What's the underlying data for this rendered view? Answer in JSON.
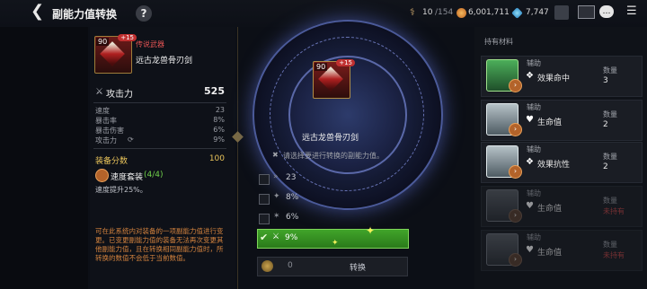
{
  "header": {
    "title": "副能力值转换",
    "help": "?",
    "resources": {
      "stamina": "10",
      "stamina_max": "/154",
      "gold": "6,001,711",
      "gems": "7,747"
    }
  },
  "weapon": {
    "level": "90",
    "enhance": "+15",
    "grade": "传说武器",
    "name": "远古龙兽骨刃剑",
    "attack_label": "攻击力",
    "attack_value": "525",
    "stats": [
      {
        "label": "速度",
        "value": "23"
      },
      {
        "label": "暴击率",
        "value": "8%"
      },
      {
        "label": "暴击伤害",
        "value": "6%"
      },
      {
        "label": "攻击力",
        "value": "9%"
      }
    ],
    "score_label": "装备分数",
    "score_value": "100",
    "set_name": "速度套装",
    "set_count": "(4/4)",
    "set_desc": "速度提升25%。",
    "notice": "可在此系统内对装备的一项副能力值进行变更。已变更副能力值的装备无法再次变更其他副能力值，且在转换相同副能力值时，所转换的数值不会低于当前数值。"
  },
  "center": {
    "level": "90",
    "enhance": "+15",
    "name": "远古龙兽骨刃剑",
    "instruction": "请选择要进行转换的副能力值。",
    "options": [
      {
        "value": "23"
      },
      {
        "value": "8%"
      },
      {
        "value": "6%"
      },
      {
        "value": "9%"
      }
    ],
    "cost": "0",
    "convert_label": "转换"
  },
  "materials": {
    "title": "持有材料",
    "qty_label": "数量",
    "items": [
      {
        "type": "辅助",
        "name": "效果命中",
        "qty": "3"
      },
      {
        "type": "辅助",
        "name": "生命值",
        "qty": "2"
      },
      {
        "type": "辅助",
        "name": "效果抗性",
        "qty": "2"
      },
      {
        "type": "辅助",
        "name": "生命值",
        "qty": "未持有"
      },
      {
        "type": "辅助",
        "name": "生命值",
        "qty": "未持有"
      }
    ]
  },
  "colors": {
    "accent_gold": "#e8c35a",
    "legend_red": "#e25353",
    "selected_green": "#41a42a"
  }
}
